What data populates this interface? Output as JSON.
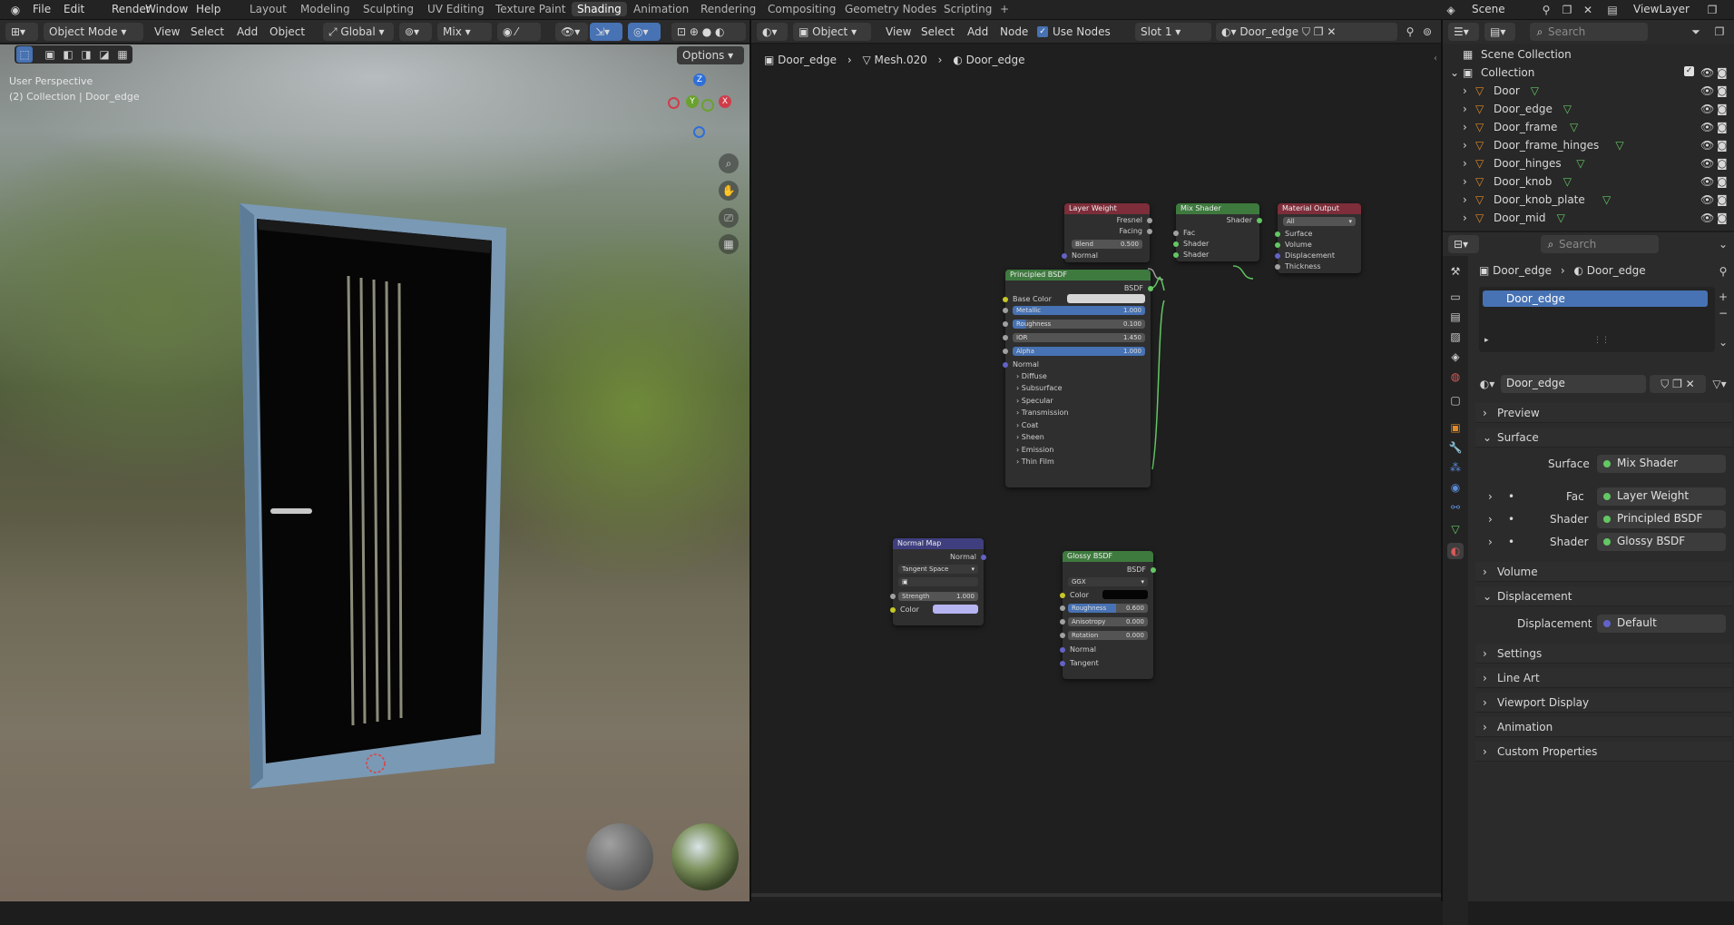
{
  "topbar": {
    "menus": [
      "File",
      "Edit",
      "Render",
      "Window",
      "Help"
    ],
    "workspaces": [
      "Layout",
      "Modeling",
      "Sculpting",
      "UV Editing",
      "Texture Paint",
      "Shading",
      "Animation",
      "Rendering",
      "Compositing",
      "Geometry Nodes",
      "Scripting"
    ],
    "active_workspace": "Shading",
    "add_tab": "+",
    "scene": "Scene",
    "view_layer": "ViewLayer"
  },
  "viewport": {
    "mode": "Object Mode",
    "menus": [
      "View",
      "Select",
      "Add",
      "Object"
    ],
    "orientation": "Global",
    "pivot": "Mix",
    "options": "Options",
    "overlay_line1": "User Perspective",
    "overlay_line2": "(2) Collection | Door_edge",
    "gizmo": {
      "z": "Z",
      "y": "Y",
      "x": "X"
    }
  },
  "node_editor": {
    "type": "Object",
    "menus": [
      "View",
      "Select",
      "Add",
      "Node"
    ],
    "use_nodes": "Use Nodes",
    "slot": "Slot 1",
    "material": "Door_edge",
    "breadcrumb": [
      "Door_edge",
      "Mesh.020",
      "Door_edge"
    ],
    "nodes": {
      "layer_weight": {
        "title": "Layer Weight",
        "out1": "Fresnel",
        "out2": "Facing",
        "blend_label": "Blend",
        "blend_value": "0.500",
        "normal": "Normal"
      },
      "mix_shader": {
        "title": "Mix Shader",
        "out": "Shader",
        "fac": "Fac",
        "in1": "Shader",
        "in2": "Shader"
      },
      "material_output": {
        "title": "Material Output",
        "target": "All",
        "surface": "Surface",
        "volume": "Volume",
        "displacement": "Displacement",
        "thickness": "Thickness"
      },
      "principled": {
        "title": "Principled BSDF",
        "out": "BSDF",
        "base_color": "Base Color",
        "fields": [
          {
            "label": "Metallic",
            "value": "1.000"
          },
          {
            "label": "Roughness",
            "value": "0.100"
          },
          {
            "label": "IOR",
            "value": "1.450"
          },
          {
            "label": "Alpha",
            "value": "1.000"
          }
        ],
        "normal": "Normal",
        "panels": [
          "Diffuse",
          "Subsurface",
          "Specular",
          "Transmission",
          "Coat",
          "Sheen",
          "Emission",
          "Thin Film"
        ]
      },
      "normal_map": {
        "title": "Normal Map",
        "out": "Normal",
        "space": "Tangent Space",
        "strength_label": "Strength",
        "strength_value": "1.000",
        "color": "Color"
      },
      "glossy": {
        "title": "Glossy BSDF",
        "out": "BSDF",
        "dist": "GGX",
        "color": "Color",
        "roughness_label": "Roughness",
        "roughness_value": "0.600",
        "anisotropy_label": "Anisotropy",
        "anisotropy_value": "0.000",
        "rotation_label": "Rotation",
        "rotation_value": "0.000",
        "normal": "Normal",
        "tangent": "Tangent"
      }
    }
  },
  "outliner": {
    "search_placeholder": "Search",
    "scene_collection": "Scene Collection",
    "collection": "Collection",
    "items": [
      "Door",
      "Door_edge",
      "Door_frame",
      "Door_frame_hinges",
      "Door_hinges",
      "Door_knob",
      "Door_knob_plate",
      "Door_mid"
    ]
  },
  "properties": {
    "search_placeholder": "Search",
    "breadcrumb_object": "Door_edge",
    "breadcrumb_material": "Door_edge",
    "slot_item": "Door_edge",
    "material_name": "Door_edge",
    "sections": {
      "preview": "Preview",
      "surface": "Surface",
      "volume": "Volume",
      "displacement": "Displacement",
      "settings": "Settings",
      "line_art": "Line Art",
      "viewport_display": "Viewport Display",
      "animation": "Animation",
      "custom_properties": "Custom Properties"
    },
    "surface_label": "Surface",
    "surface_value": "Mix Shader",
    "fac_label": "Fac",
    "fac_value": "Layer Weight",
    "shader1_label": "Shader",
    "shader1_value": "Principled BSDF",
    "shader2_label": "Shader",
    "shader2_value": "Glossy BSDF",
    "disp_label": "Displacement",
    "disp_value": "Default"
  },
  "colors": {
    "accent": "#4772b3",
    "node_green": "#3e7a3e",
    "node_red": "#7e2d3a",
    "node_purple": "#3f3f7f",
    "socket_green": "#63c763"
  }
}
